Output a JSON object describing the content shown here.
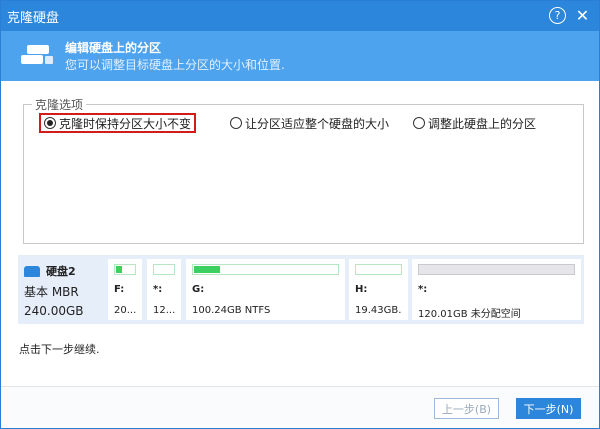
{
  "window": {
    "title": "克隆硬盘",
    "help_icon": "?",
    "close_icon": "✕"
  },
  "header": {
    "title": "编辑硬盘上的分区",
    "subtitle": "您可以调整目标硬盘上分区的大小和位置."
  },
  "options": {
    "group_label": "克隆选项",
    "items": [
      {
        "label": "克隆时保持分区大小不变",
        "selected": true
      },
      {
        "label": "让分区适应整个硬盘的大小",
        "selected": false
      },
      {
        "label": "调整此硬盘上的分区",
        "selected": false
      }
    ]
  },
  "disk": {
    "name": "硬盘2",
    "type": "基本 MBR",
    "size": "240.00GB",
    "partitions": [
      {
        "letter": "F:",
        "info": "20...",
        "used_fraction": 0.12
      },
      {
        "letter": "*:",
        "info": "12...",
        "used_fraction": 0
      },
      {
        "letter": "G:",
        "info": "100.24GB NTFS",
        "used_fraction": 0.18
      },
      {
        "letter": "H:",
        "info": "19.43GB...",
        "used_fraction": 0
      },
      {
        "letter": "*:",
        "info": "120.01GB 未分配空间",
        "used_fraction": 0
      }
    ]
  },
  "hint": "点击下一步继续.",
  "buttons": {
    "back": "上一步(B)",
    "next": "下一步(N)"
  }
}
